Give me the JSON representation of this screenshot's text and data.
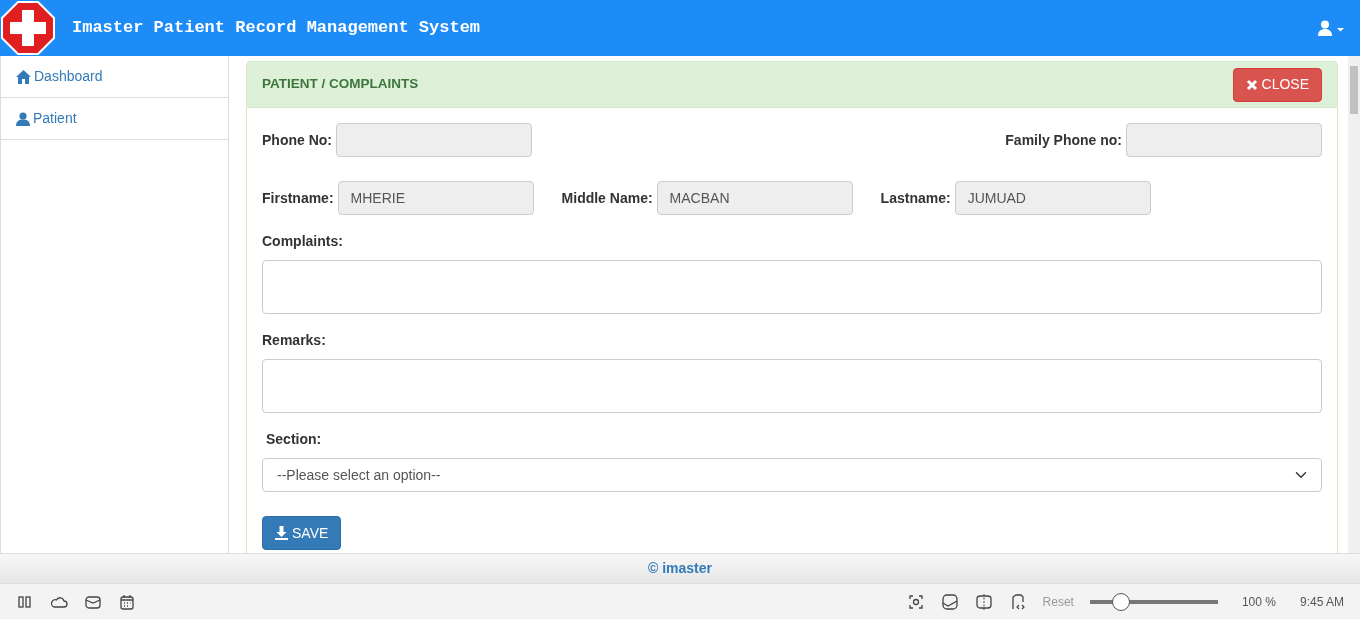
{
  "header": {
    "title": "Imaster Patient Record Management System"
  },
  "sidebar": {
    "items": [
      {
        "label": "Dashboard",
        "kind": "home"
      },
      {
        "label": "Patient",
        "kind": "user"
      }
    ]
  },
  "panel": {
    "title": "PATIENT / COMPLAINTS",
    "close_button": "CLOSE",
    "top_row": [
      {
        "label": "Phone No:"
      },
      {
        "label": "Family Phone no:"
      }
    ],
    "name_row": [
      {
        "label": "Firstname:",
        "value": "MHERIE"
      },
      {
        "label": "Middle Name:",
        "value": "MACBAN"
      },
      {
        "label": "Lastname:",
        "value": "JUMUAD"
      }
    ],
    "text_areas": [
      {
        "label": "Complaints:"
      },
      {
        "label": "Remarks:"
      }
    ],
    "section": {
      "label": "Section:",
      "value": "--Please select an option--"
    },
    "save_button": "SAVE"
  },
  "footer": {
    "text": "© imaster"
  },
  "status_bar": {
    "reset": "Reset",
    "zoom": {
      "level": 0.2
    },
    "zoom_reading": "100 %",
    "time": "9:45 AM"
  }
}
